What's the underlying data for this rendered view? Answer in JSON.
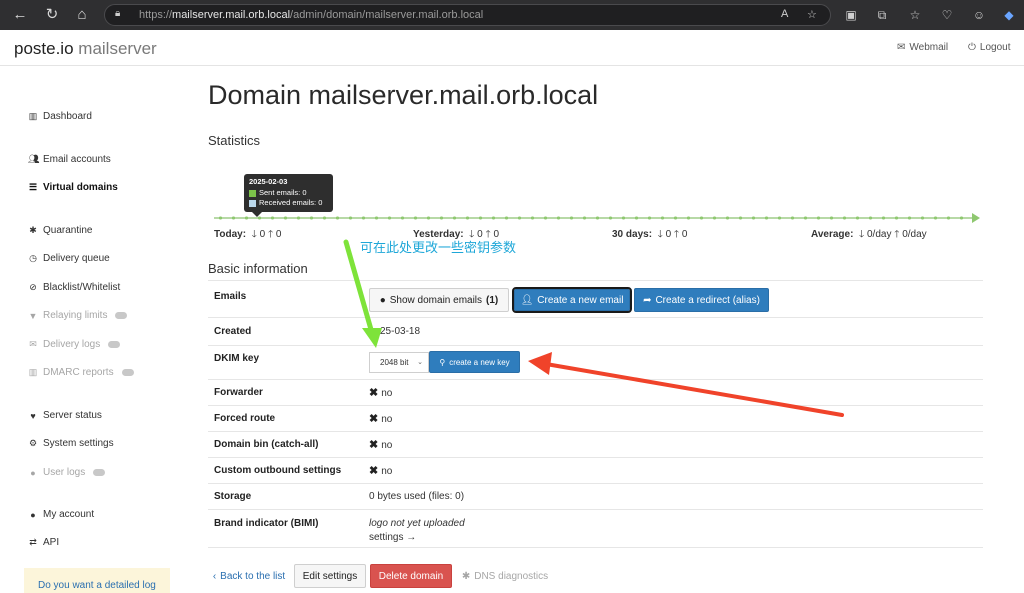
{
  "browser": {
    "url_scheme": "https://",
    "url_host": "mailserver.mail.orb.local",
    "url_path": "/admin/domain/mailserver.mail.orb.local"
  },
  "header": {
    "brand_main": "poste.io",
    "brand_sub": "mailserver",
    "webmail": "Webmail",
    "logout": "Logout"
  },
  "sidebar": {
    "items": [
      {
        "label": "Dashboard"
      },
      {
        "label": "Email accounts"
      },
      {
        "label": "Virtual domains"
      },
      {
        "label": "Quarantine"
      },
      {
        "label": "Delivery queue"
      },
      {
        "label": "Blacklist/Whitelist"
      },
      {
        "label": "Relaying limits"
      },
      {
        "label": "Delivery logs"
      },
      {
        "label": "DMARC reports"
      },
      {
        "label": "Server status"
      },
      {
        "label": "System settings"
      },
      {
        "label": "User logs"
      },
      {
        "label": "My account"
      },
      {
        "label": "API"
      }
    ],
    "promo": "Do you want a detailed log"
  },
  "main": {
    "title": "Domain mailserver.mail.orb.local",
    "statistics_heading": "Statistics",
    "tooltip": {
      "date": "2025-02-03",
      "sent": "Sent emails: 0",
      "received": "Received emails: 0",
      "sent_color": "#7cc24a",
      "received_color": "#bcd9ec"
    },
    "stats": {
      "today_label": "Today:",
      "today_down": "0",
      "today_up": "0",
      "yesterday_label": "Yesterday:",
      "yesterday_down": "0",
      "yesterday_up": "0",
      "days30_label": "30 days:",
      "days30_down": "0",
      "days30_up": "0",
      "average_label": "Average:",
      "average_down": "0/day",
      "average_up": "0/day"
    },
    "annotation": "可在此处更改一些密钥参数",
    "basic_heading": "Basic information",
    "rows": {
      "emails": "Emails",
      "show_domain_emails": "Show domain emails",
      "email_count": "(1)",
      "create_email": "Create a new email",
      "create_redirect": "Create a redirect (alias)",
      "created": "Created",
      "created_value": "25-03-18",
      "dkim": "DKIM key",
      "dkim_select": "2048 bit",
      "create_key": "create a new key",
      "forwarder": "Forwarder",
      "forwarder_value": "no",
      "forced_route": "Forced route",
      "forced_route_value": "no",
      "domain_bin": "Domain bin (catch-all)",
      "domain_bin_value": "no",
      "custom_outbound": "Custom outbound settings",
      "custom_outbound_value": "no",
      "storage": "Storage",
      "storage_value": "0 bytes used (files: 0)",
      "brand": "Brand indicator (BIMI)",
      "brand_value": "logo not yet uploaded",
      "brand_settings": "settings →"
    },
    "footer": {
      "back": "Back to the list",
      "edit": "Edit settings",
      "delete": "Delete domain",
      "dns": "DNS diagnostics"
    }
  },
  "colors": {
    "primary": "#2f7dbd",
    "danger": "#d9534f",
    "green_arrow": "#7ee33a",
    "red_arrow": "#f0432a"
  }
}
